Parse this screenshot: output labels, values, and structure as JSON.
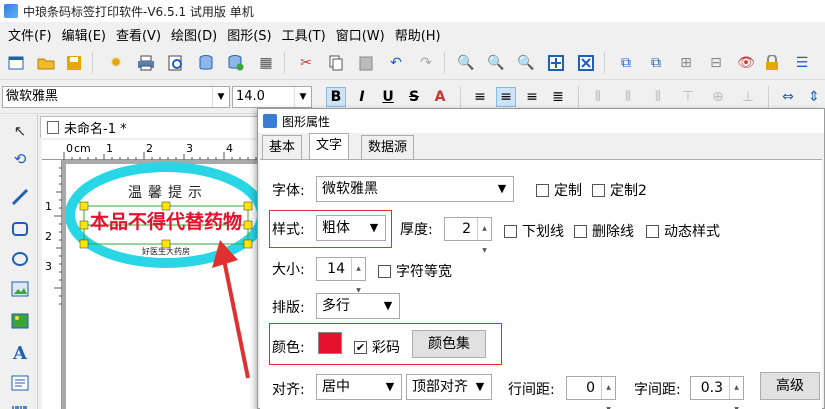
{
  "window": {
    "title": "中琅条码标签打印软件-V6.5.1 试用版 单机"
  },
  "menu": [
    "文件(F)",
    "编辑(E)",
    "查看(V)",
    "绘图(D)",
    "图形(S)",
    "工具(T)",
    "窗口(W)",
    "帮助(H)"
  ],
  "toolbar2": {
    "font_name": "微软雅黑",
    "font_size": "14.0",
    "bold": "B",
    "italic": "I",
    "underline": "U",
    "strike": "S"
  },
  "document": {
    "tab_title": "未命名-1 *",
    "ruler_unit": "cm",
    "ruler_top_marks": [
      "0",
      "1",
      "2",
      "3",
      "4"
    ],
    "ruler_left_marks": [
      "1",
      "2",
      "3"
    ],
    "label_arc_text": "温馨提示",
    "label_main_text": "本品不得代替药物",
    "label_bottom_text": "好医生大药房"
  },
  "dialog": {
    "title": "图形属性",
    "tabs": [
      "基本",
      "文字",
      "数据源"
    ],
    "active_tab": "文字",
    "font_label": "字体:",
    "font_value": "微软雅黑",
    "custom_label": "定制",
    "custom2_label": "定制2",
    "style_label": "样式:",
    "style_value": "粗体",
    "thickness_label": "厚度:",
    "thickness_value": "2",
    "underline_label": "下划线",
    "strike_label": "删除线",
    "dynamic_style_label": "动态样式",
    "size_label": "大小:",
    "size_value": "14",
    "equal_width_label": "字符等宽",
    "layout_label": "排版:",
    "layout_value": "多行",
    "color_label": "颜色:",
    "color_value": "#e8112d",
    "color_code_label": "彩码",
    "color_code_checked": "✔",
    "color_set_button": "颜色集",
    "align_label": "对齐:",
    "align_value": "居中",
    "valign_value": "顶部对齐",
    "line_spacing_label": "行间距:",
    "line_spacing_value": "0",
    "char_spacing_label": "字间距:",
    "char_spacing_value": "0.3",
    "advanced_button": "高级"
  },
  "colors": {
    "label_border": "#29d6e6",
    "label_text": "#e8112d",
    "annotation": "#e03030"
  }
}
